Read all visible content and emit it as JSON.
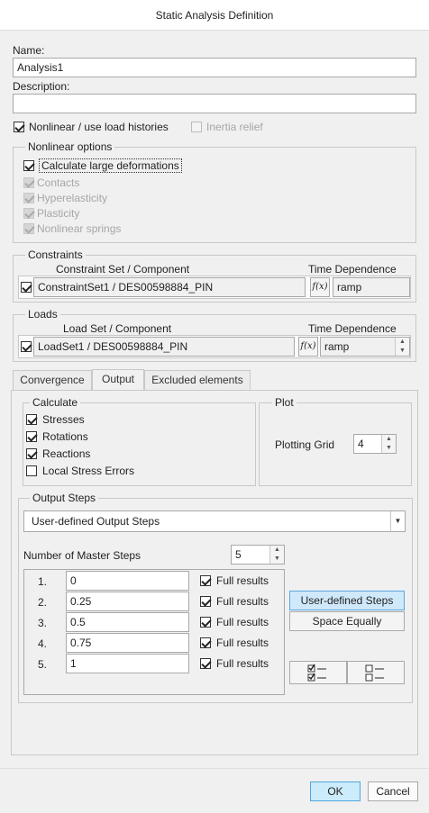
{
  "window": {
    "title": "Static Analysis Definition"
  },
  "name": {
    "label": "Name:",
    "value": "Analysis1"
  },
  "description": {
    "label": "Description:",
    "value": ""
  },
  "nonlinear_check": {
    "label": "Nonlinear / use load histories",
    "checked": true
  },
  "inertia_relief": {
    "label": "Inertia relief",
    "checked": false,
    "enabled": false
  },
  "nonlinear_options": {
    "title": "Nonlinear options",
    "items": [
      {
        "label": "Calculate large deformations",
        "checked": true,
        "enabled": true
      },
      {
        "label": "Contacts",
        "checked": true,
        "enabled": false
      },
      {
        "label": "Hyperelasticity",
        "checked": true,
        "enabled": false
      },
      {
        "label": "Plasticity",
        "checked": true,
        "enabled": false
      },
      {
        "label": "Nonlinear springs",
        "checked": true,
        "enabled": false
      }
    ]
  },
  "constraints": {
    "title": "Constraints",
    "col_set": "Constraint Set / Component",
    "col_time": "Time Dependence",
    "row": {
      "name": "ConstraintSet1 / DES00598884_PIN",
      "fx": "f(x)",
      "time": "ramp"
    }
  },
  "loads": {
    "title": "Loads",
    "col_set": "Load Set / Component",
    "col_time": "Time Dependence",
    "row": {
      "name": "LoadSet1 / DES00598884_PIN",
      "fx": "f(x)",
      "time": "ramp"
    }
  },
  "tabs": [
    "Convergence",
    "Output",
    "Excluded elements"
  ],
  "active_tab": "Output",
  "calculate": {
    "title": "Calculate",
    "items": [
      {
        "label": "Stresses",
        "checked": true
      },
      {
        "label": "Rotations",
        "checked": true
      },
      {
        "label": "Reactions",
        "checked": true
      },
      {
        "label": "Local Stress Errors",
        "checked": false
      }
    ]
  },
  "plot": {
    "title": "Plot",
    "grid_label": "Plotting Grid",
    "grid_value": "4"
  },
  "output_steps": {
    "title": "Output Steps",
    "mode": "User-defined Output Steps",
    "master_label": "Number of Master Steps",
    "master_value": "5",
    "steps": [
      {
        "num": "1.",
        "value": "0",
        "full": "Full results"
      },
      {
        "num": "2.",
        "value": "0.25",
        "full": "Full results"
      },
      {
        "num": "3.",
        "value": "0.5",
        "full": "Full results"
      },
      {
        "num": "4.",
        "value": "0.75",
        "full": "Full results"
      },
      {
        "num": "5.",
        "value": "1",
        "full": "Full results"
      }
    ],
    "btn_user": "User-defined Steps",
    "btn_equal": "Space Equally"
  },
  "footer": {
    "ok": "OK",
    "cancel": "Cancel"
  },
  "colors": {
    "accent": "#cfe8fa",
    "accent_border": "#4ea7dc"
  }
}
